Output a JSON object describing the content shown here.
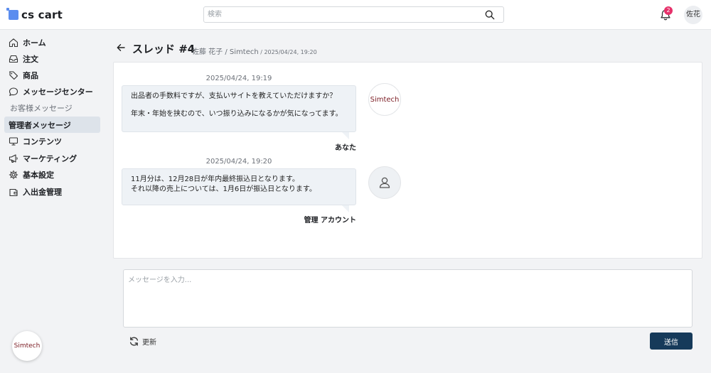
{
  "header": {
    "logo_text": "cs cart",
    "search_placeholder": "検索",
    "notification_count": "2",
    "user_initials": "佐花"
  },
  "sidebar": {
    "items": [
      {
        "label": "ホーム",
        "icon": "home-icon"
      },
      {
        "label": "注文",
        "icon": "inbox-icon"
      },
      {
        "label": "商品",
        "icon": "tag-icon"
      },
      {
        "label": "メッセージセンター",
        "icon": "chat-icon"
      },
      {
        "label": "お客様メッセージ",
        "icon": ""
      },
      {
        "label": "管理者メッセージ",
        "icon": "",
        "active": true
      },
      {
        "label": "コンテンツ",
        "icon": "monitor-icon"
      },
      {
        "label": "マーケティング",
        "icon": "megaphone-icon"
      },
      {
        "label": "基本設定",
        "icon": "gear-icon"
      },
      {
        "label": "入出金管理",
        "icon": "wallet-icon"
      }
    ],
    "store_badge": "Simtech"
  },
  "thread": {
    "title": "スレッド #4",
    "participants": "佐藤 花子 / Simtech",
    "separator": " / ",
    "date": "2025/04/24, 19:20"
  },
  "messages": [
    {
      "timestamp": "2025/04/24, 19:19",
      "lines": [
        "出品者の手数料ですが、支払いサイトを教えていただけますか？",
        "",
        "年末・年始を挟むので、いつ振り込みになるかが気になってます。"
      ],
      "sender": "あなた",
      "avatar_label": "Simtech"
    },
    {
      "timestamp": "2025/04/24, 19:20",
      "lines": [
        "11月分は、12月28日が年内最終振込日となります。",
        "それ以降の売上については、1月6日が振込日となります。"
      ],
      "sender": "管理 アカウント",
      "avatar_label": ""
    }
  ],
  "composer": {
    "placeholder": "メッセージを入力...",
    "refresh_label": "更新",
    "send_label": "送信"
  },
  "colors": {
    "accent": "#163a5a",
    "badge": "#e6316a",
    "logo": "#5b8def",
    "store": "#7a1b22"
  }
}
